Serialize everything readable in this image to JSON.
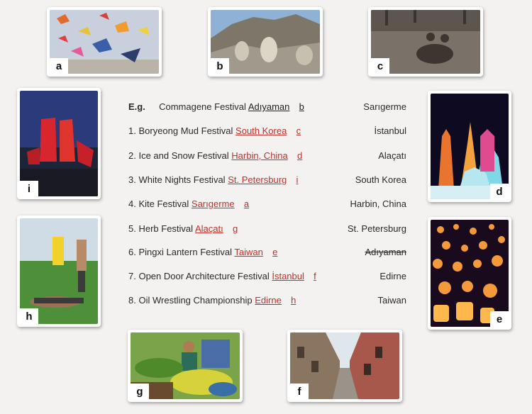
{
  "photos": {
    "a": "a",
    "b": "b",
    "c": "c",
    "d": "d",
    "e": "e",
    "f": "f",
    "g": "g",
    "h": "h",
    "i": "i"
  },
  "example": {
    "prefix": "E.g.",
    "festival": "Commagene Festival",
    "answer": "Adıyaman",
    "letter": "b",
    "place": "Sarıgerme"
  },
  "items": [
    {
      "num": "1.",
      "festival": "Boryeong Mud Festival",
      "answer": "South Korea",
      "letter": "c",
      "place": "İstanbul"
    },
    {
      "num": "2.",
      "festival": "Ice and Snow Festival",
      "answer": "Harbin, China",
      "letter": "d",
      "place": "Alaçatı"
    },
    {
      "num": "3.",
      "festival": "White Nights Festival",
      "answer": "St. Petersburg",
      "letter": "i",
      "place": "South Korea"
    },
    {
      "num": "4.",
      "festival": "Kite Festival",
      "answer": "Sarıgerme",
      "letter": "a",
      "place": "Harbin, China"
    },
    {
      "num": "5.",
      "festival": "Herb Festival",
      "answer": "Alaçatı",
      "letter": "g",
      "place": "St. Petersburg"
    },
    {
      "num": "6.",
      "festival": "Pingxi Lantern Festival",
      "answer": "Taiwan",
      "letter": "e",
      "place": "Adıyaman"
    },
    {
      "num": "7.",
      "festival": "Open Door Architecture Festival",
      "answer": "İstanbul",
      "letter": "f",
      "place": "Edirne"
    },
    {
      "num": "8.",
      "festival": "Oil Wrestling Championship",
      "answer": "Edirne",
      "letter": "h",
      "place": "Taiwan"
    }
  ],
  "colors": {
    "answer": "#c0312b",
    "background": "#f4f2f0"
  }
}
